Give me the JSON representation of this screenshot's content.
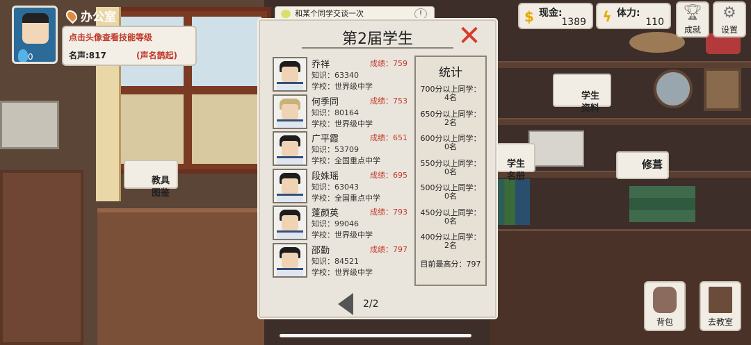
{
  "location": {
    "name": "办公室"
  },
  "player": {
    "level": "0"
  },
  "info_card": {
    "hint": "点击头像查看技能等级",
    "fame": "名声:817",
    "fame_title": "(声名鹊起)"
  },
  "quest": {
    "text": "和某个同学交谈一次"
  },
  "hud": {
    "cash_label": "现金:",
    "cash_value": "1389",
    "stamina_label": "体力:",
    "stamina_value": "110",
    "achievements_label": "成就",
    "settings_label": "设置"
  },
  "scene_tags": {
    "student_info": "学生\n资料",
    "student_roster": "学生\n名册",
    "repair": "修葺",
    "teaching_tools": "教具\n图鉴"
  },
  "panel": {
    "title": "第2届学生",
    "close_glyph": "✕",
    "students": [
      {
        "name": "乔祥",
        "grade": "成绩：759",
        "knowledge": "知识：63340",
        "school": "学校：世界级中学"
      },
      {
        "name": "何季同",
        "grade": "成绩：753",
        "knowledge": "知识：80164",
        "school": "学校：世界级中学"
      },
      {
        "name": "广平霞",
        "grade": "成绩：651",
        "knowledge": "知识：53709",
        "school": "学校：全国重点中学"
      },
      {
        "name": "段姝瑶",
        "grade": "成绩：695",
        "knowledge": "知识：63043",
        "school": "学校：全国重点中学"
      },
      {
        "name": "蓬颜英",
        "grade": "成绩：793",
        "knowledge": "知识：99046",
        "school": "学校：世界级中学"
      },
      {
        "name": "邵勤",
        "grade": "成绩：797",
        "knowledge": "知识：84521",
        "school": "学校：世界级中学"
      }
    ],
    "stats": {
      "heading": "统计",
      "items": [
        {
          "label": "700分以上同学：",
          "count": "4名"
        },
        {
          "label": "650分以上同学：",
          "count": "2名"
        },
        {
          "label": "600分以上同学：",
          "count": "0名"
        },
        {
          "label": "550分以上同学：",
          "count": "0名"
        },
        {
          "label": "500分以上同学：",
          "count": "0名"
        },
        {
          "label": "450分以上同学：",
          "count": "0名"
        },
        {
          "label": "400分以上同学：",
          "count": "2名"
        }
      ],
      "best": "目前最高分：797"
    },
    "page": "2/2"
  },
  "bottom": {
    "backpack_label": "背包",
    "classroom_label": "去教室"
  }
}
